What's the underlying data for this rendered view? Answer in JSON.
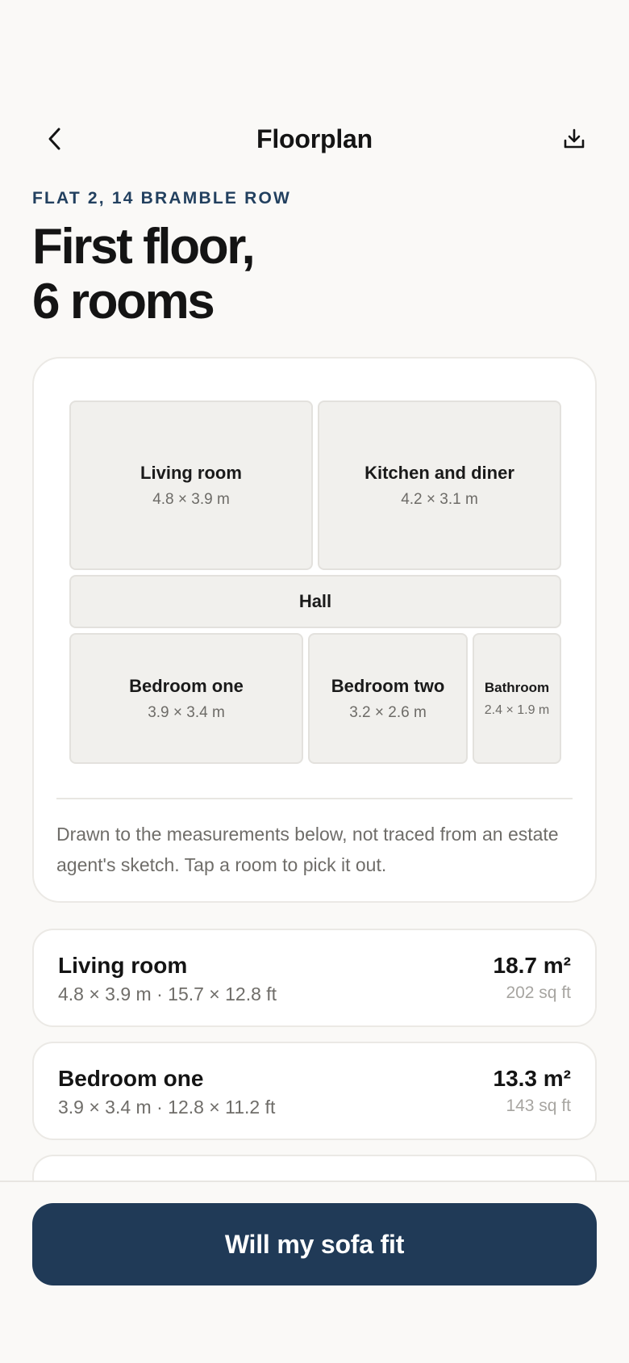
{
  "header": {
    "title": "Floorplan",
    "back_icon": "chevron-left-icon",
    "download_icon": "download-icon"
  },
  "property": {
    "eyebrow": "FLAT 2, 14 BRAMBLE ROW",
    "headline_line1": "First floor,",
    "headline_line2": "6 rooms"
  },
  "plan": {
    "rooms": [
      {
        "name": "Living room",
        "dims": "4.8 × 3.9 m"
      },
      {
        "name": "Kitchen and diner",
        "dims": "4.2 × 3.1 m"
      },
      {
        "name": "Hall",
        "dims": ""
      },
      {
        "name": "Bedroom one",
        "dims": "3.9 × 3.4 m"
      },
      {
        "name": "Bedroom two",
        "dims": "3.2 × 2.6 m"
      },
      {
        "name": "Bathroom",
        "dims": "2.4 × 1.9 m"
      }
    ],
    "note": "Drawn to the measurements below, not traced from an estate agent's sketch. Tap a room to pick it out."
  },
  "room_list": [
    {
      "name": "Living room",
      "dims": "4.8 × 3.9 m · 15.7 × 12.8 ft",
      "area": "18.7 m²",
      "sqft": "202 sq ft"
    },
    {
      "name": "Bedroom one",
      "dims": "3.9 × 3.4 m · 12.8 × 11.2 ft",
      "area": "13.3 m²",
      "sqft": "143 sq ft"
    }
  ],
  "cta": {
    "label": "Will my sofa fit"
  },
  "colors": {
    "accent": "#203a57",
    "eyebrow": "#22405f",
    "background": "#faf9f7",
    "room_fill": "#f1f0ed"
  }
}
